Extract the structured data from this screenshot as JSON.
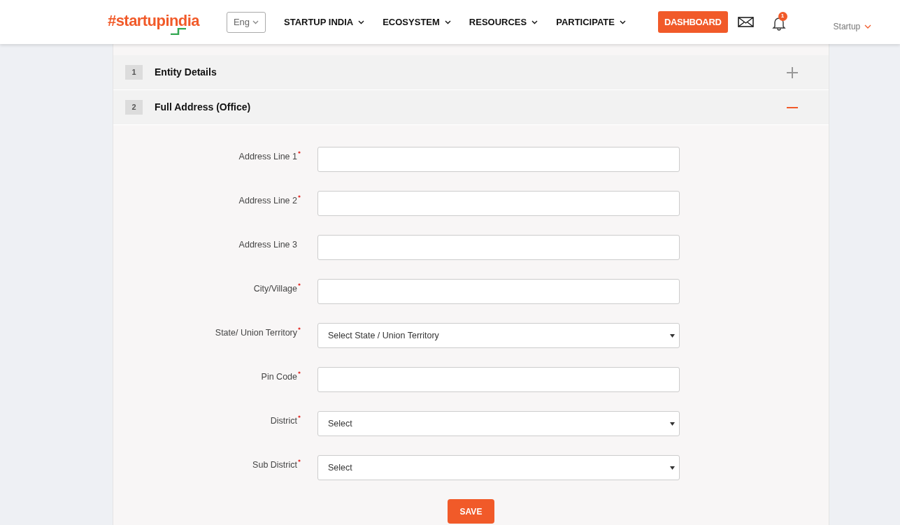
{
  "header": {
    "logo": "#startupindia",
    "language": "Eng",
    "nav": [
      {
        "label": "STARTUP INDIA"
      },
      {
        "label": "ECOSYSTEM"
      },
      {
        "label": "RESOURCES"
      },
      {
        "label": "PARTICIPATE"
      }
    ],
    "dashboard_button": "DASHBOARD",
    "notification_count": "1",
    "user_menu": "Startup"
  },
  "sections": [
    {
      "number": "1",
      "title": "Entity Details",
      "expanded": false
    },
    {
      "number": "2",
      "title": "Full Address (Office)",
      "expanded": true
    }
  ],
  "fields": [
    {
      "label": "Address Line 1",
      "required": true,
      "kind": "text"
    },
    {
      "label": "Address Line 2",
      "required": true,
      "kind": "text"
    },
    {
      "label": "Address Line 3",
      "required": false,
      "kind": "text"
    },
    {
      "label": "City/Village",
      "required": true,
      "kind": "text"
    },
    {
      "label": "State/ Union Territory",
      "required": true,
      "kind": "select",
      "value": "Select State / Union Territory"
    },
    {
      "label": "Pin Code",
      "required": true,
      "kind": "text"
    },
    {
      "label": "District",
      "required": true,
      "kind": "select",
      "value": "Select"
    },
    {
      "label": "Sub District",
      "required": true,
      "kind": "select",
      "value": "Select"
    }
  ],
  "save_button": "SAVE"
}
